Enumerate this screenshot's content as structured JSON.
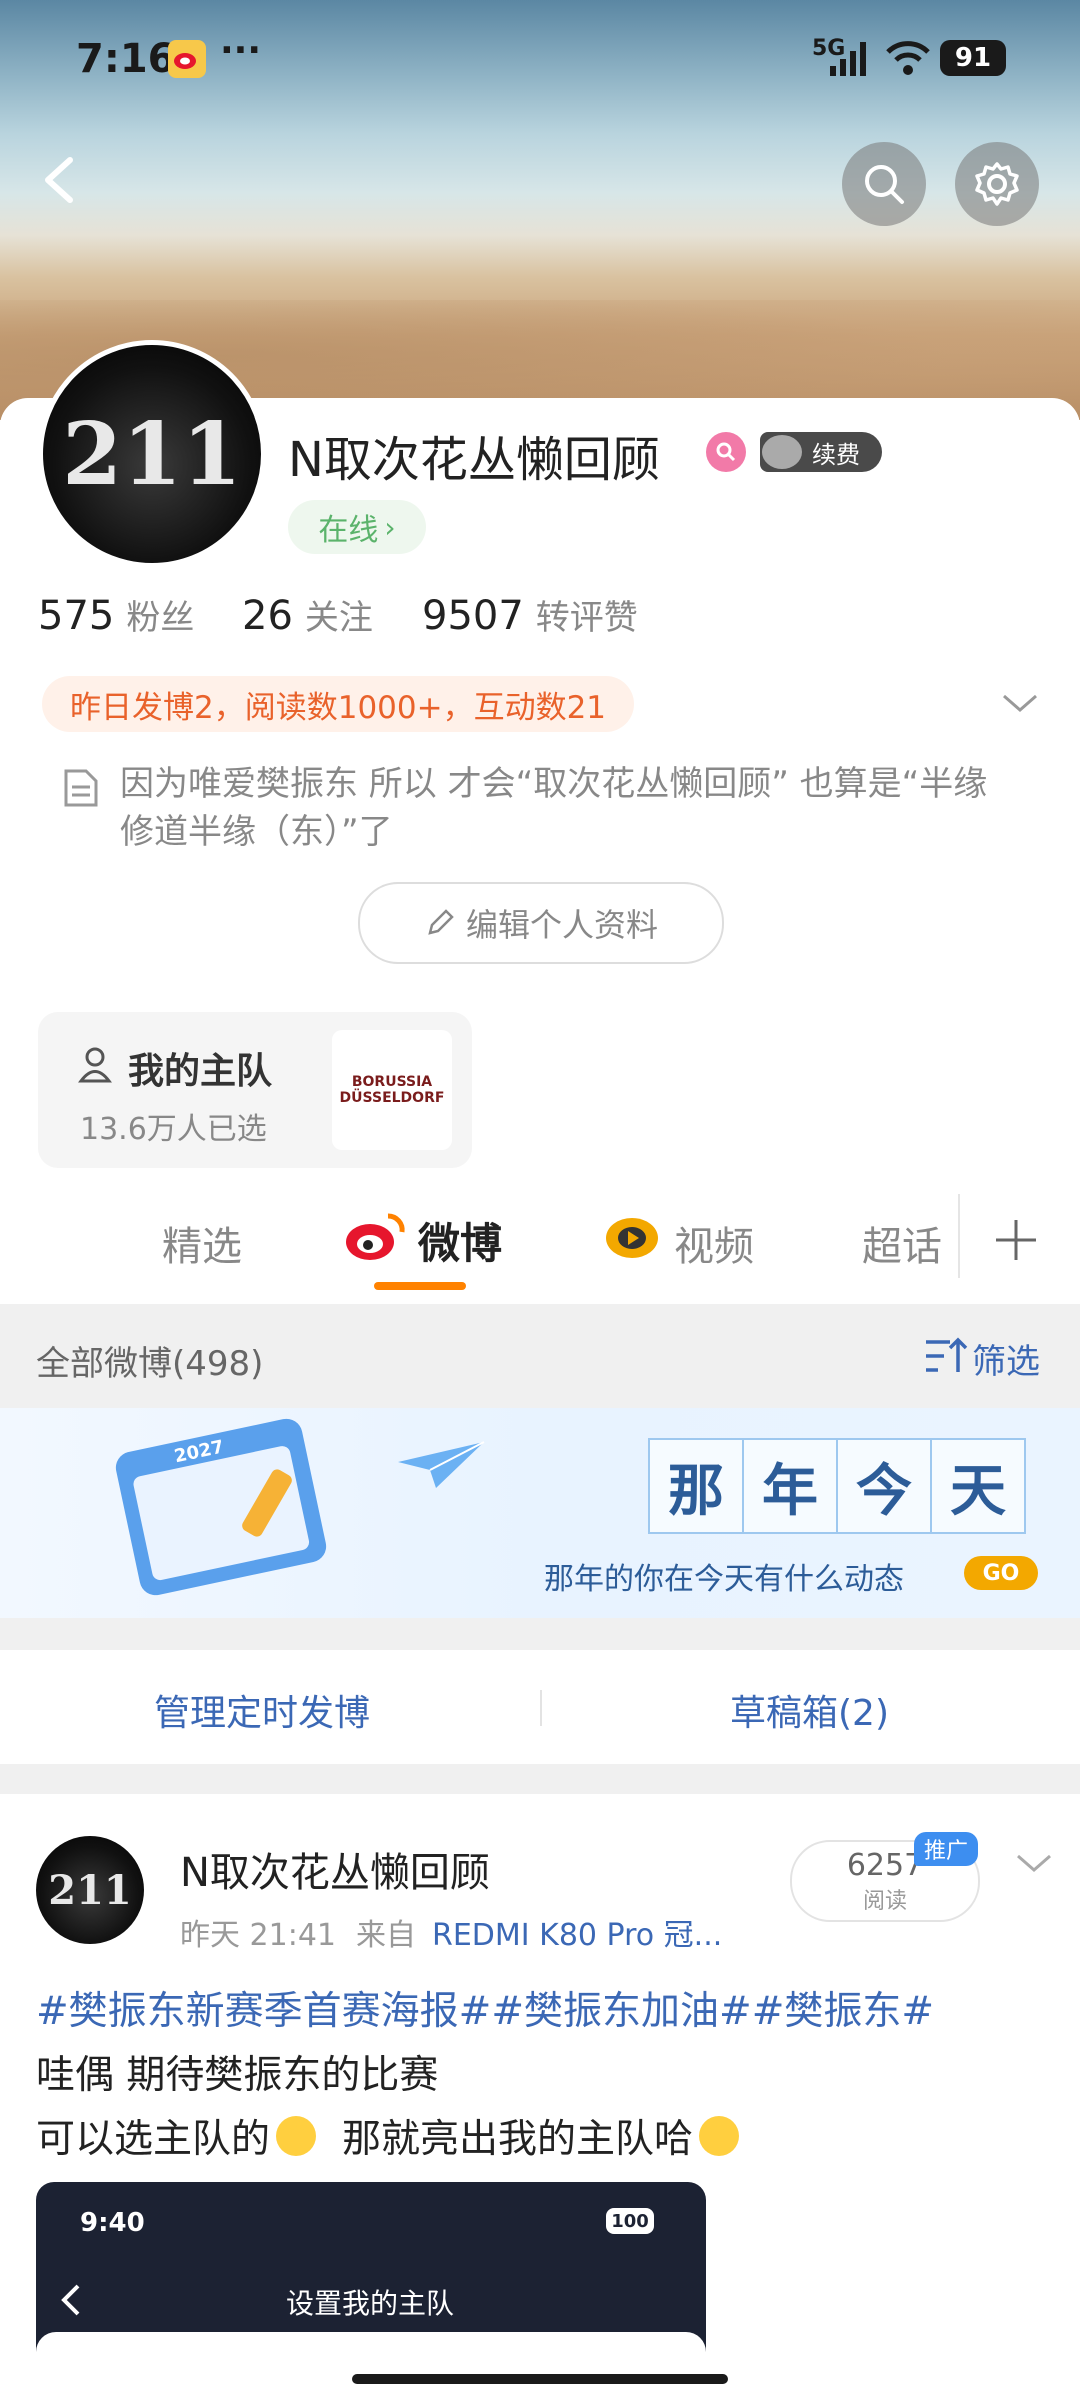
{
  "status_bar": {
    "time": "7:16",
    "dots": "···",
    "network": "5G",
    "battery": "91"
  },
  "profile": {
    "name": "N取次花丛懒回顾",
    "avatar_text": "211",
    "online": "在线",
    "vip_label": "续费",
    "stats": [
      {
        "value": "575",
        "label": "粉丝"
      },
      {
        "value": "26",
        "label": "关注"
      },
      {
        "value": "9507",
        "label": "转评赞"
      }
    ],
    "yesterday_banner": "昨日发博2，阅读数1000+，互动数21",
    "bio": "因为唯爱樊振东 所以 才会“取次花丛懒回顾” 也算是“半缘修道半缘（东）”了",
    "edit_button": "编辑个人资料"
  },
  "team": {
    "title": "我的主队",
    "count": "13.6万人已选",
    "logo_line1": "BORUSSIA",
    "logo_line2": "DÜSSELDORF"
  },
  "tabs": [
    {
      "label": "精选",
      "active": false
    },
    {
      "label": "微博",
      "active": true
    },
    {
      "label": "视频",
      "active": false
    },
    {
      "label": "超话",
      "active": false
    }
  ],
  "feed_header": {
    "all": "全部微博(498)",
    "filter": "筛选"
  },
  "memory_banner": {
    "chars": [
      "那",
      "年",
      "今",
      "天"
    ],
    "subtitle": "那年的你在今天有什么动态",
    "go": "GO",
    "calendar_year": "2027"
  },
  "actions": {
    "scheduled": "管理定时发博",
    "drafts": "草稿箱(2)"
  },
  "post": {
    "author": "N取次花丛懒回顾",
    "avatar_text": "211",
    "time": "昨天 21:41",
    "source_prefix": "来自",
    "source": "REDMI K80 Pro 冠...",
    "reads": "6257",
    "reads_label": "阅读",
    "promote": "推广",
    "hashtags": "#樊振东新赛季首赛海报##樊振东加油##樊振东#",
    "line1": "哇偶 期待樊振东的比赛",
    "line2a": "可以选主队的",
    "line2b": "那就亮出我的主队哈"
  },
  "embedded_screenshot": {
    "time": "9:40",
    "battery": "100",
    "title": "设置我的主队"
  },
  "colors": {
    "accent": "#ff8200",
    "link": "#3b68b5",
    "online": "#5bb36b",
    "banner_text": "#e9622b"
  }
}
